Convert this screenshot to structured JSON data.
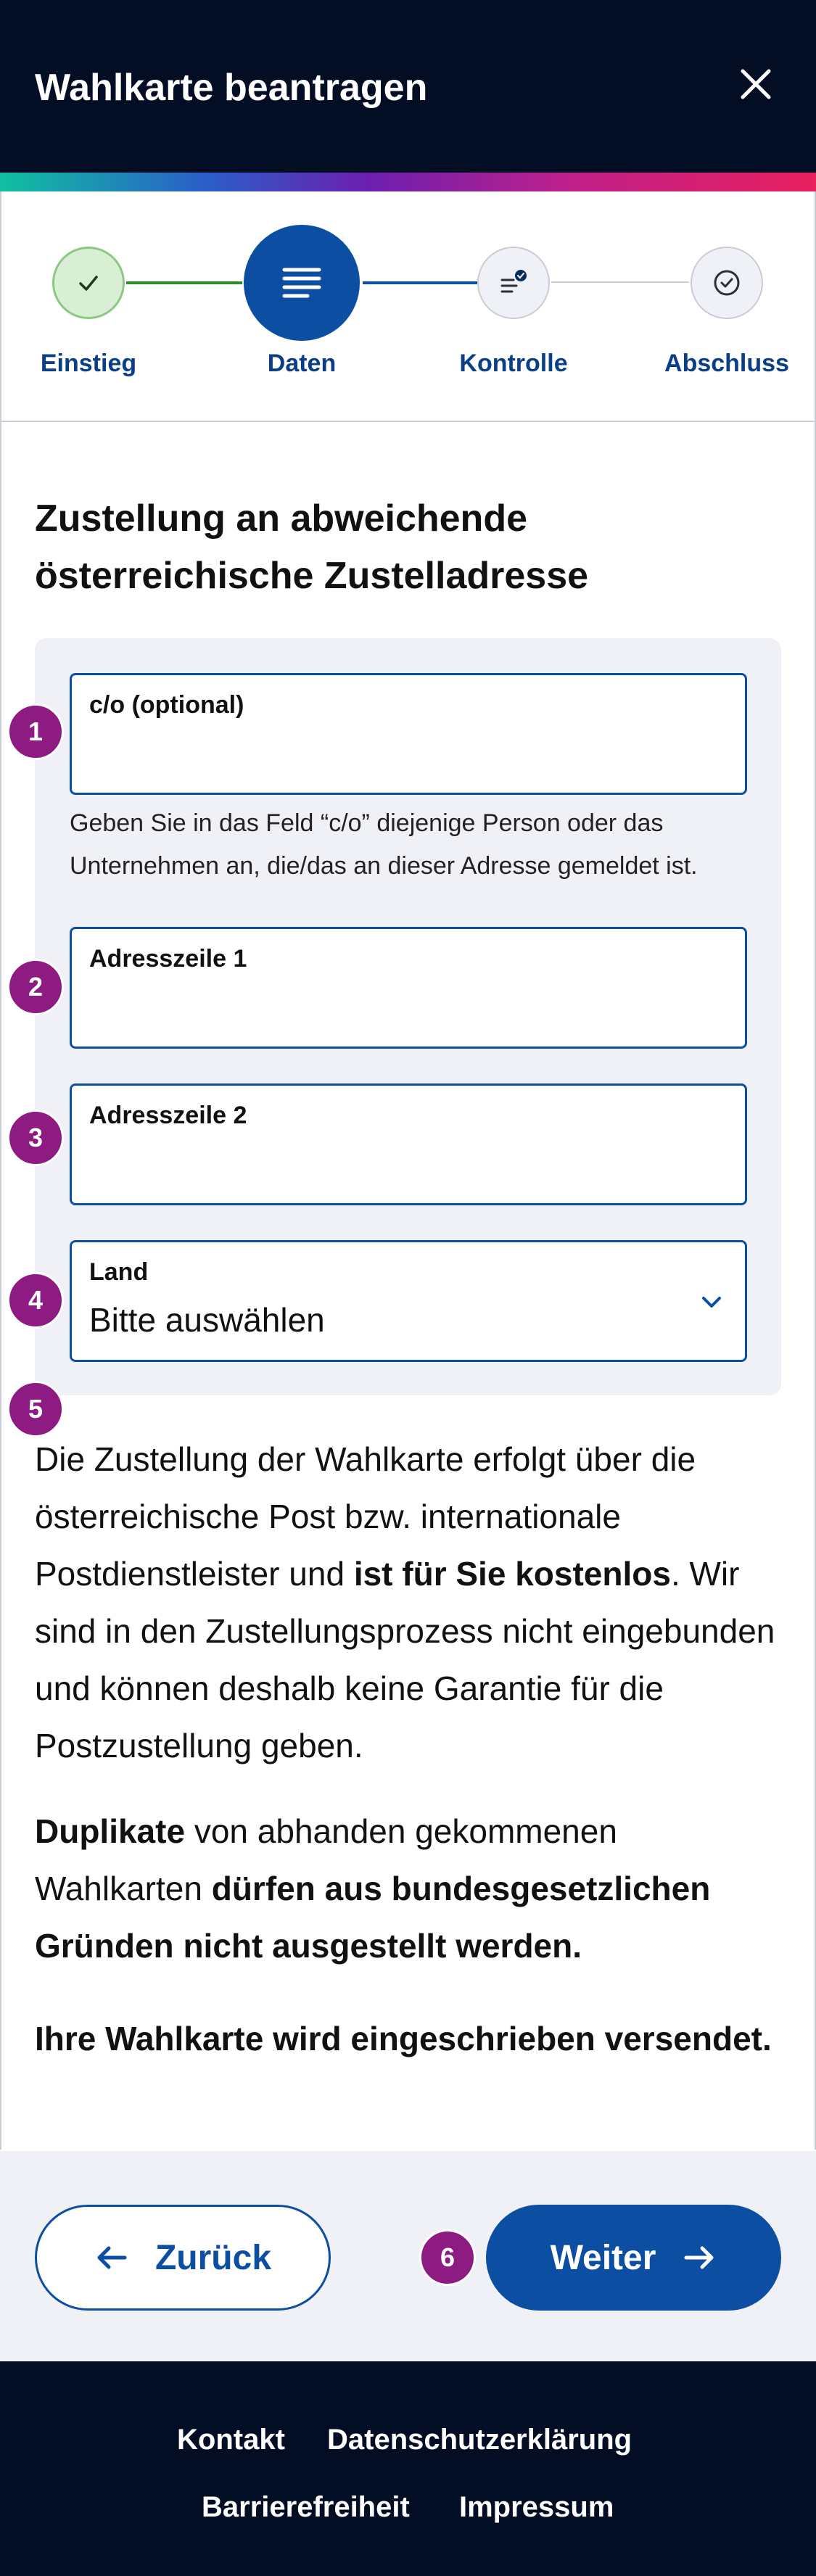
{
  "header": {
    "title": "Wahlkarte beantragen",
    "close_icon": "close-icon"
  },
  "colors": {
    "header_bg": "#030d24",
    "primary": "#0b4ea2",
    "badge": "#8e1b82",
    "panel_bg": "#eff1f6",
    "step_done_bg": "#d8efd4",
    "step_done_line": "#2f8a2a"
  },
  "stepper": {
    "steps": [
      {
        "label": "Einstieg",
        "state": "completed",
        "icon": "check-icon"
      },
      {
        "label": "Daten",
        "state": "active",
        "icon": "lines-icon"
      },
      {
        "label": "Kontrolle",
        "state": "pending",
        "icon": "list-check-icon"
      },
      {
        "label": "Abschluss",
        "state": "pending",
        "icon": "circle-check-icon"
      }
    ]
  },
  "section": {
    "title": "Zustellung an abweichende österreichische Zustelladresse"
  },
  "form": {
    "co": {
      "label": "c/o (optional)",
      "value": "",
      "badge": "1"
    },
    "co_help": "Geben Sie in das Feld “c/o” diejenige Person oder das Unternehmen an, die/das an dieser Adresse gemeldet ist.",
    "address1": {
      "label": "Adresszeile 1",
      "value": "",
      "badge": "2"
    },
    "address2": {
      "label": "Adresszeile 2",
      "value": "",
      "badge": "3"
    },
    "country": {
      "label": "Land",
      "value": "Bitte auswählen",
      "badge": "4"
    }
  },
  "info": {
    "badge": "5",
    "p1_a": "Die Zustellung der Wahlkarte erfolgt über die österreichische Post bzw. internationale Postdienstleister und ",
    "p1_b": "ist für Sie kostenlos",
    "p1_c": ". Wir sind in den Zustellungsprozess nicht eingebunden und können deshalb keine Garantie für die Postzustellung geben.",
    "p2_a": "Duplikate",
    "p2_b": " von abhanden gekommenen Wahlkarten ",
    "p2_c": "dürfen aus bundesgesetzlichen Gründen nicht ausgestellt werden.",
    "p3": "Ihre Wahlkarte wird eingeschrieben versendet."
  },
  "actions": {
    "back_label": "Zurück",
    "next_label": "Weiter",
    "next_badge": "6"
  },
  "footer": {
    "links": [
      "Kontakt",
      "Datenschutzerklärung",
      "Barrierefreiheit",
      "Impressum"
    ]
  }
}
